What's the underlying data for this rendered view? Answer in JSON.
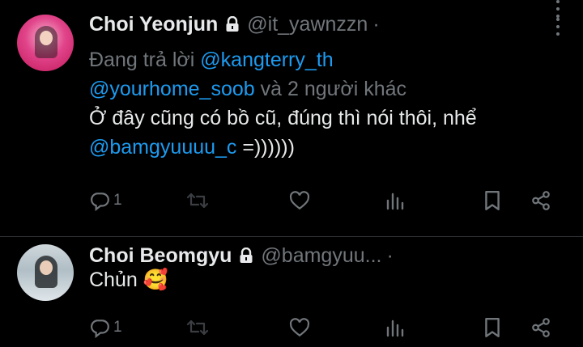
{
  "colors": {
    "background": "#000000",
    "text": "#e7e9ea",
    "muted": "#71767b",
    "link": "#1d9bf0",
    "divider": "#2f3336"
  },
  "tweets": [
    {
      "display_name": "Choi Yeonjun",
      "handle": "@it_yawnzzn",
      "separator": "·",
      "lock_icon": "lock-icon",
      "replying_prefix": "Đang trả lời ",
      "replying_user_1": "@kangterry_th",
      "replying_user_2": "@yourhome_soob",
      "replying_suffix": " và 2 người khác",
      "text": "Ở đây cũng có bồ cũ, đúng thì nói thôi, nhể",
      "mention": "@bamgyuuuu_c",
      "text_suffix": " =))))))",
      "reply_count": "1"
    },
    {
      "display_name": "Choi Beomgyu",
      "handle": "@bamgyuu...",
      "separator": "·",
      "lock_icon": "lock-icon",
      "text": "Chủn",
      "emoji": "🥰",
      "reply_count": "1"
    }
  ]
}
